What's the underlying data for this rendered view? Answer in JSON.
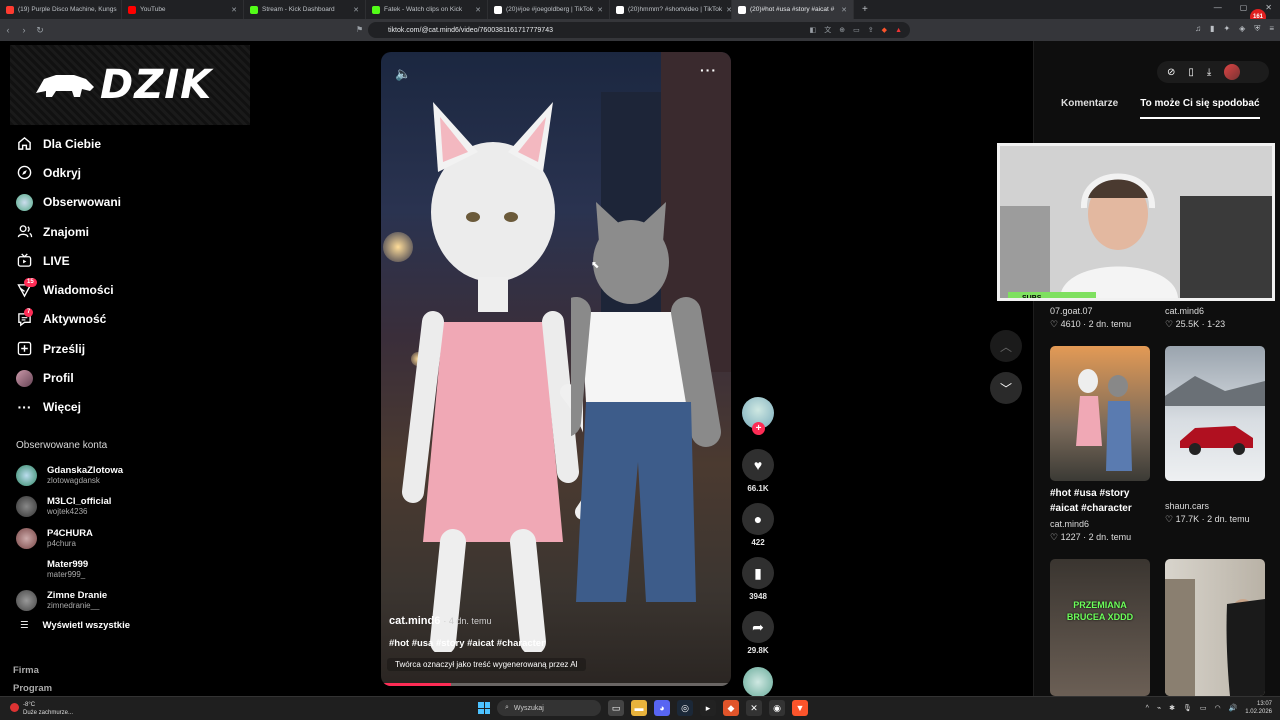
{
  "browser": {
    "tabs": [
      {
        "title": "(19) Purple Disco Machine, Kungs",
        "color": "#ff3b30",
        "active": false
      },
      {
        "title": "YouTube",
        "color": "#ff0000",
        "active": false
      },
      {
        "title": "Stream - Kick Dashboard",
        "color": "#53fc18",
        "active": false
      },
      {
        "title": "Fatek - Watch clips on Kick",
        "color": "#53fc18",
        "active": false
      },
      {
        "title": "(20)#joe #joegoldberg | TikTok",
        "color": "#ffffff",
        "active": false
      },
      {
        "title": "(20)hmmm? #shortvideo | TikTok",
        "color": "#ffffff",
        "active": false
      },
      {
        "title": "(20)#hot #usa #story #aicat #",
        "color": "#ffffff",
        "active": true
      }
    ],
    "url": "tiktok.com/@cat.mind6/video/7600381161717779743",
    "rec_badge": "161"
  },
  "sidebar": {
    "logo_text": "DZIK",
    "menu": [
      {
        "label": "Dla Ciebie",
        "icon": "home-icon"
      },
      {
        "label": "Odkryj",
        "icon": "compass-icon"
      },
      {
        "label": "Obserwowani",
        "icon": "following-avatar-icon"
      },
      {
        "label": "Znajomi",
        "icon": "friends-icon"
      },
      {
        "label": "LIVE",
        "icon": "live-tv-icon"
      },
      {
        "label": "Wiadomości",
        "icon": "inbox-icon",
        "badge": "15"
      },
      {
        "label": "Aktywność",
        "icon": "activity-icon",
        "badge": "7"
      },
      {
        "label": "Prześlij",
        "icon": "upload-icon"
      },
      {
        "label": "Profil",
        "icon": "profile-avatar-icon"
      },
      {
        "label": "Więcej",
        "icon": "more-icon"
      }
    ],
    "followed_title": "Obserwowane konta",
    "followed": [
      {
        "name": "GdanskaZlotowa",
        "handle": "zlotowagdansk"
      },
      {
        "name": "M3LCI_official",
        "handle": "wojtek4236"
      },
      {
        "name": "P4CHURA",
        "handle": "p4chura"
      },
      {
        "name": "Mater999",
        "handle": "mater999_"
      },
      {
        "name": "Zimne Dranie",
        "handle": "zimnedranie__"
      }
    ],
    "see_all": "Wyświetl wszystkie",
    "footer": [
      "Firma",
      "Program"
    ]
  },
  "video": {
    "author": "cat.mind6",
    "time": "· 4 dn. temu",
    "tags": "#hot #usa #story #aicat #character",
    "ai_label": "Twórca oznaczył jako treść wygenerowaną przez AI",
    "progress": 0.2
  },
  "actions": {
    "likes": "66.1K",
    "comments": "422",
    "saves": "3948",
    "shares": "29.8K"
  },
  "right_panel": {
    "tabs": [
      "Komentarze",
      "To może Ci się spodobać"
    ],
    "active_tab": 1,
    "cards": [
      {
        "user": "07.goat.07",
        "stats": "♡ 4610 · 2 dn. temu"
      },
      {
        "user": "cat.mind6",
        "stats": "♡ 25.5K · 1-23"
      },
      {
        "title": "#hot #usa #story #aicat #character",
        "user": "cat.mind6",
        "stats": "♡ 1227 · 2 dn. temu"
      },
      {
        "user": "shaun.cars",
        "stats": "♡ 17.7K · 2 dn. temu"
      }
    ],
    "thumb_caption": "PRZEMIANA BRUCEA XDDD"
  },
  "webcam": {
    "subs_label": "SUBS"
  },
  "taskbar": {
    "weather_temp": "-8°C",
    "weather_text": "Duże zachmurze...",
    "search_placeholder": "Wyszukaj",
    "time": "13:07",
    "date": "1.02.2026"
  }
}
